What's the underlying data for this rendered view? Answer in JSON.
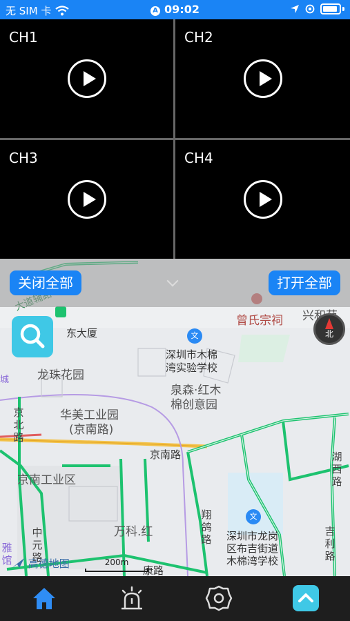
{
  "status_bar": {
    "carrier": "无 SIM 卡",
    "time": "09:02"
  },
  "video": {
    "channels": [
      {
        "label": "CH1"
      },
      {
        "label": "CH2"
      },
      {
        "label": "CH3"
      },
      {
        "label": "CH4"
      }
    ]
  },
  "controls": {
    "close_all": "关闭全部",
    "open_all": "打开全部"
  },
  "map": {
    "labels": {
      "zeng_shi": "曾氏宗祠",
      "xinghe": "兴和苑",
      "dongda": "东大厦",
      "school1_a": "深圳市木棉",
      "school1_b": "湾实验学校",
      "longzhu": "龙珠花园",
      "quansen_a": "泉森·红木",
      "quansen_b": "棉创意园",
      "huamei_a": "华美工业园",
      "huamei_b": "(京南路)",
      "jingnan_road": "京南路",
      "jingnan_park": "京南工业区",
      "wanke": "万科.红",
      "school2_a": "深圳市龙岗",
      "school2_b": "区布吉街道",
      "school2_c": "木棉湾学校",
      "kang_road": "康路",
      "jingbei": "京北路",
      "huxi": "湖西路",
      "jili": "吉利路",
      "xiang": "翔鸽路",
      "zhongyuan": "中元路",
      "yaguan": "雅馆",
      "dadao": "大道辅路",
      "cheng": "城"
    },
    "compass_label": "北",
    "brand": "高德地图",
    "scale": "200m"
  },
  "icons": {
    "home": "home-icon",
    "alarm": "alarm-icon",
    "settings": "gear-icon",
    "collapse": "chevron-up-icon"
  },
  "colors": {
    "accent": "#1a84f5",
    "road_green": "#1dc26f",
    "search_bg": "#3fc8e6"
  }
}
